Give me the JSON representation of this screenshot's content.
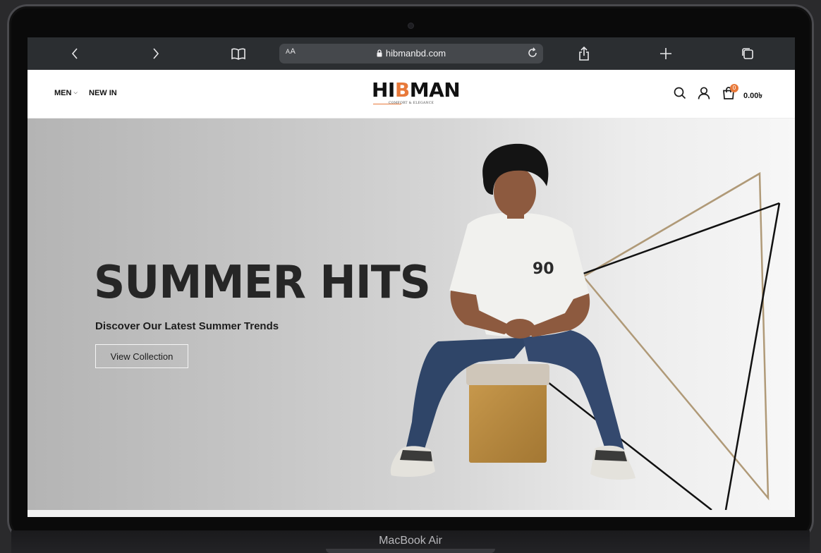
{
  "device": {
    "label": "MacBook Air"
  },
  "browser": {
    "text_size_label": "AA",
    "url": "hibmanbd.com",
    "buttons": {
      "back": "back",
      "forward": "forward",
      "bookmarks": "bookmarks",
      "share": "share",
      "new_tab": "new tab",
      "tabs": "tabs"
    }
  },
  "site": {
    "nav": [
      {
        "label": "MEN",
        "has_dropdown": true
      },
      {
        "label": "NEW IN",
        "has_dropdown": false
      }
    ],
    "logo": {
      "text_before": "HI",
      "text_accent": "B",
      "text_after": "MAN",
      "tagline": "COMFORT & ELEGANCE"
    },
    "header_icons": [
      "search-icon",
      "user-icon",
      "cart-icon"
    ],
    "cart": {
      "count": "0",
      "total": "0.00৳"
    }
  },
  "hero": {
    "title": "SUMMER HITS",
    "subtitle": "Discover Our Latest Summer Trends",
    "cta": "View Collection"
  },
  "colors": {
    "accent": "#e8793a",
    "toolbar": "#2b2e31",
    "hero_text": "#262626",
    "triangle_gold": "#b09a78",
    "triangle_black": "#111111"
  }
}
